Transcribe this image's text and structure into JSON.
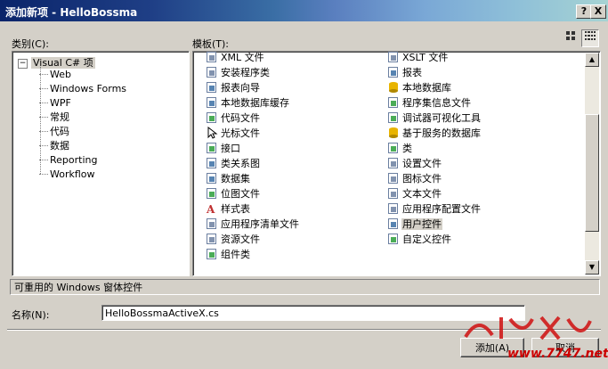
{
  "window": {
    "title": "添加新项 - HelloBossma",
    "help_btn": "?",
    "close_btn": "X"
  },
  "categories": {
    "label": "类别(C):",
    "root": "Visual C# 项",
    "root_expander": "−",
    "items": [
      "Web",
      "Windows Forms",
      "WPF",
      "常规",
      "代码",
      "数据",
      "Reporting",
      "Workflow"
    ]
  },
  "templates": {
    "label": "模板(T):",
    "view_icons": [
      "large-icons-view-icon",
      "small-icons-view-icon"
    ],
    "left_col": [
      {
        "label": "XML 文件",
        "icon": "xml-file-icon"
      },
      {
        "label": "安装程序类",
        "icon": "installer-class-icon"
      },
      {
        "label": "报表向导",
        "icon": "report-wizard-icon"
      },
      {
        "label": "本地数据库缓存",
        "icon": "local-db-cache-icon"
      },
      {
        "label": "代码文件",
        "icon": "code-file-icon"
      },
      {
        "label": "光标文件",
        "icon": "cursor-file-icon"
      },
      {
        "label": "接口",
        "icon": "interface-icon"
      },
      {
        "label": "类关系图",
        "icon": "class-diagram-icon"
      },
      {
        "label": "数据集",
        "icon": "dataset-icon"
      },
      {
        "label": "位图文件",
        "icon": "bitmap-file-icon"
      },
      {
        "label": "样式表",
        "icon": "stylesheet-icon"
      },
      {
        "label": "应用程序清单文件",
        "icon": "manifest-file-icon"
      },
      {
        "label": "资源文件",
        "icon": "resource-file-icon"
      },
      {
        "label": "组件类",
        "icon": "component-class-icon"
      }
    ],
    "right_col": [
      {
        "label": "XSLT 文件",
        "icon": "xslt-file-icon"
      },
      {
        "label": "报表",
        "icon": "report-icon"
      },
      {
        "label": "本地数据库",
        "icon": "local-database-icon"
      },
      {
        "label": "程序集信息文件",
        "icon": "assembly-info-icon"
      },
      {
        "label": "调试器可视化工具",
        "icon": "debugger-visualizer-icon"
      },
      {
        "label": "基于服务的数据库",
        "icon": "service-database-icon"
      },
      {
        "label": "类",
        "icon": "class-icon"
      },
      {
        "label": "设置文件",
        "icon": "settings-file-icon"
      },
      {
        "label": "图标文件",
        "icon": "icon-file-icon"
      },
      {
        "label": "文本文件",
        "icon": "text-file-icon"
      },
      {
        "label": "应用程序配置文件",
        "icon": "app-config-icon"
      },
      {
        "label": "用户控件",
        "icon": "user-control-icon",
        "selected": true
      },
      {
        "label": "自定义控件",
        "icon": "custom-control-icon"
      }
    ]
  },
  "description": "可重用的 Windows 窗体控件",
  "name_field": {
    "label": "名称(N):",
    "value": "HelloBossmaActiveX.cs"
  },
  "buttons": {
    "add": "添加(A)",
    "cancel": "取消"
  },
  "watermark": {
    "text": "红黑联盟",
    "url": "www.7747.net"
  }
}
